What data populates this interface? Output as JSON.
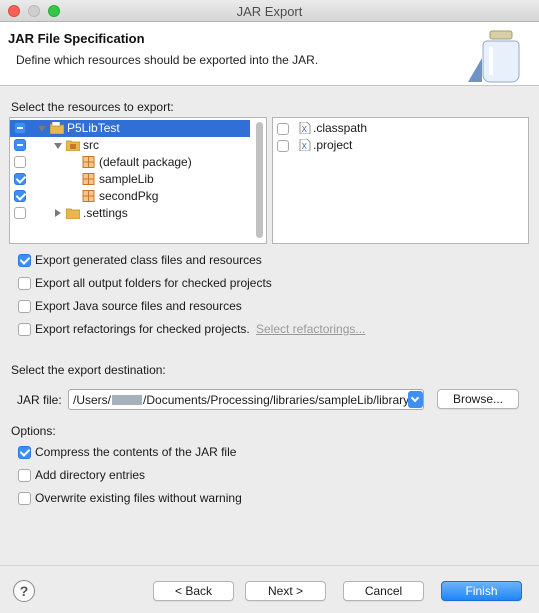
{
  "window": {
    "title": "JAR Export"
  },
  "banner": {
    "title": "JAR File Specification",
    "description": "Define which resources should be exported into the JAR."
  },
  "resources": {
    "label": "Select the resources to export:",
    "tree": [
      {
        "label": "P5LibTest",
        "state": "mixed",
        "expanded": true,
        "selected": true,
        "icon": "project-folder-icon"
      },
      {
        "label": "src",
        "state": "mixed",
        "expanded": true,
        "icon": "source-folder-icon"
      },
      {
        "label": "(default package)",
        "state": "unchecked",
        "icon": "package-icon"
      },
      {
        "label": "sampleLib",
        "state": "checked",
        "icon": "package-icon"
      },
      {
        "label": "secondPkg",
        "state": "checked",
        "icon": "package-icon"
      },
      {
        "label": ".settings",
        "state": "unchecked",
        "expanded": false,
        "icon": "folder-icon"
      }
    ],
    "files": [
      {
        "label": ".classpath",
        "checked": false,
        "icon": "xml-file-icon"
      },
      {
        "label": ".project",
        "checked": false,
        "icon": "xml-file-icon"
      }
    ]
  },
  "export_options": [
    {
      "label": "Export generated class files and resources",
      "checked": true
    },
    {
      "label": "Export all output folders for checked projects",
      "checked": false
    },
    {
      "label": "Export Java source files and resources",
      "checked": false
    },
    {
      "label": "Export refactorings for checked projects.",
      "checked": false
    }
  ],
  "select_refactorings_link": "Select refactorings...",
  "destination": {
    "label": "Select the export destination:",
    "jar_label": "JAR file:",
    "path_prefix": "/Users/",
    "path_suffix": "/Documents/Processing/libraries/sampleLib/library",
    "browse_label": "Browse..."
  },
  "options": {
    "label": "Options:",
    "items": [
      {
        "label": "Compress the contents of the JAR file",
        "checked": true
      },
      {
        "label": "Add directory entries",
        "checked": false
      },
      {
        "label": "Overwrite existing files without warning",
        "checked": false
      }
    ]
  },
  "footer": {
    "help": "?",
    "back": "< Back",
    "next": "Next >",
    "cancel": "Cancel",
    "finish": "Finish"
  },
  "colors": {
    "accent": "#3d8ff3",
    "selection": "#2f6fd6",
    "package": "#c9762b",
    "folder": "#e8b84c"
  }
}
